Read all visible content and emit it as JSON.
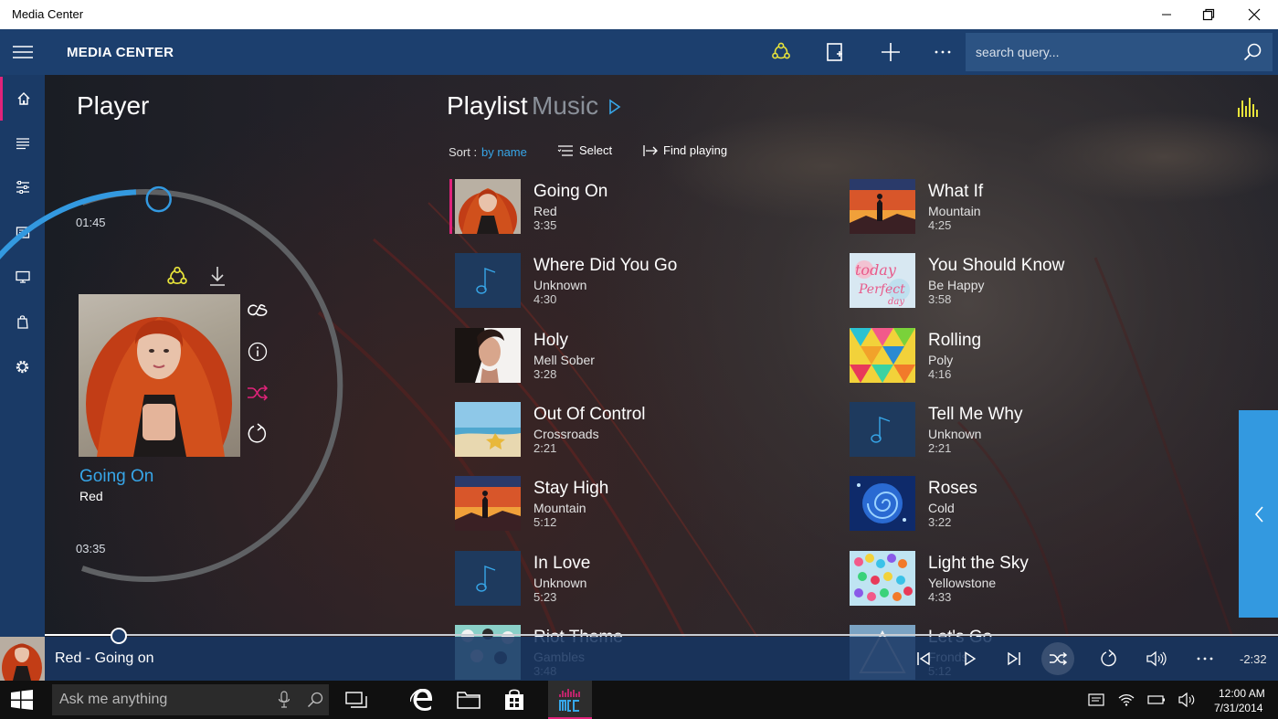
{
  "window": {
    "title": "Media Center"
  },
  "header": {
    "app_title": "MEDIA CENTER",
    "search_placeholder": "search query..."
  },
  "player": {
    "title": "Player",
    "elapsed": "01:45",
    "total": "03:35",
    "progress": 0.49,
    "now_title": "Going On",
    "now_artist": "Red"
  },
  "playlist": {
    "title": "Playlist",
    "subtitle": "Music",
    "sort_label": "Sort :",
    "sort_value": "by name",
    "select_label": "Select",
    "find_label": "Find playing",
    "tracks_left": [
      {
        "title": "Going On",
        "artist": "Red",
        "duration": "3:35",
        "art": "girl-red",
        "active": true
      },
      {
        "title": "Where Did You Go",
        "artist": "Unknown",
        "duration": "4:30",
        "art": "note"
      },
      {
        "title": "Holy",
        "artist": "Mell Sober",
        "duration": "3:28",
        "art": "girl-dark"
      },
      {
        "title": "Out Of Control",
        "artist": "Crossroads",
        "duration": "2:21",
        "art": "beach"
      },
      {
        "title": "Stay High",
        "artist": "Mountain",
        "duration": "5:12",
        "art": "sunset"
      },
      {
        "title": "In Love",
        "artist": "Unknown",
        "duration": "5:23",
        "art": "note"
      },
      {
        "title": "Riot Theme",
        "artist": "Gambles",
        "duration": "3:48",
        "art": "dots"
      }
    ],
    "tracks_right": [
      {
        "title": "What If",
        "artist": "Mountain",
        "duration": "4:25",
        "art": "sunset"
      },
      {
        "title": "You Should Know",
        "artist": "Be Happy",
        "duration": "3:58",
        "art": "today"
      },
      {
        "title": "Rolling",
        "artist": "Poly",
        "duration": "4:16",
        "art": "poly"
      },
      {
        "title": "Tell Me Why",
        "artist": "Unknown",
        "duration": "2:21",
        "art": "note"
      },
      {
        "title": "Roses",
        "artist": "Cold",
        "duration": "3:22",
        "art": "rose"
      },
      {
        "title": "Light the Sky",
        "artist": "Yellowstone",
        "duration": "4:33",
        "art": "balloons"
      },
      {
        "title": "Let's Go",
        "artist": "Fronds",
        "duration": "5:12",
        "art": "triangle"
      }
    ]
  },
  "bottom_bar": {
    "now_playing": "Red - Going on",
    "remaining": "-2:32",
    "seek_progress": 0.06
  },
  "taskbar": {
    "search_placeholder": "Ask me anything",
    "time": "12:00 AM",
    "date": "7/31/2014"
  },
  "colors": {
    "accent_blue": "#37a6e8",
    "accent_pink": "#e0237a",
    "header_bg": "#1c3f6e",
    "sidebar_bg": "#1a3a66",
    "yellow_icon": "#e8e43a"
  }
}
